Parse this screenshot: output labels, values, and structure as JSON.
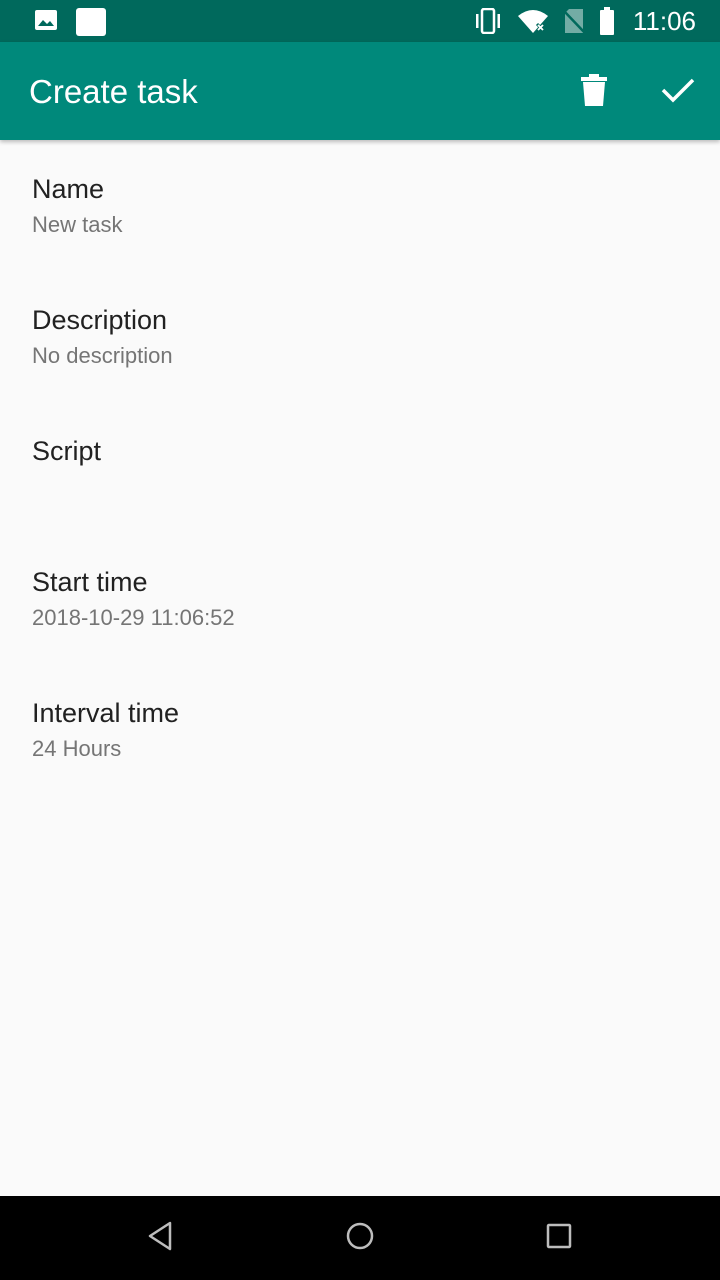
{
  "status_bar": {
    "time": "11:06",
    "icons": [
      "image-icon",
      "square-notification-icon",
      "vibrate-icon",
      "wifi-off-icon",
      "no-sim-icon",
      "battery-icon"
    ]
  },
  "app_bar": {
    "title": "Create task",
    "actions": [
      "delete-icon",
      "check-icon"
    ]
  },
  "preferences": [
    {
      "title": "Name",
      "summary": "New task"
    },
    {
      "title": "Description",
      "summary": "No description"
    },
    {
      "title": "Script",
      "summary": ""
    },
    {
      "title": "Start time",
      "summary": "2018-10-29 11:06:52"
    },
    {
      "title": "Interval time",
      "summary": "24 Hours"
    }
  ],
  "nav_bar": {
    "buttons": [
      "back-icon",
      "home-icon",
      "recents-icon"
    ]
  },
  "colors": {
    "status_bar": "#00695c",
    "app_bar": "#00897b",
    "background": "#fafafa",
    "title_text": "#212121",
    "summary_text": "#757575"
  }
}
